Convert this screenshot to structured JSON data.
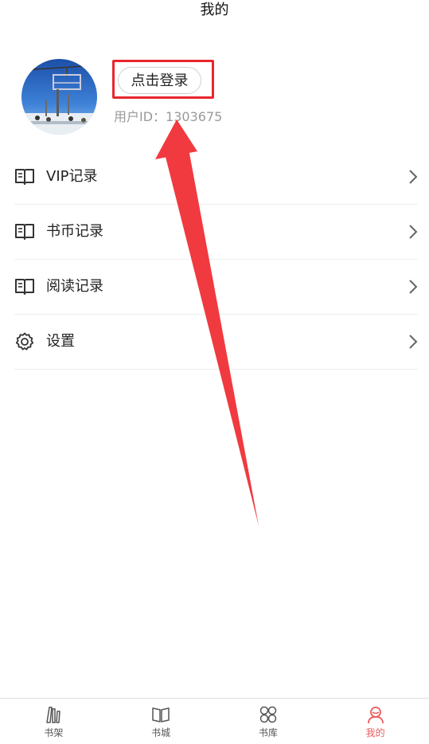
{
  "header": {
    "title": "我的"
  },
  "profile": {
    "login_label": "点击登录",
    "user_id": "用户ID：1303675"
  },
  "menu": [
    {
      "label": "VIP记录",
      "icon": "book-icon"
    },
    {
      "label": "书币记录",
      "icon": "book-icon"
    },
    {
      "label": "阅读记录",
      "icon": "book-icon"
    },
    {
      "label": "设置",
      "icon": "gear-icon"
    }
  ],
  "tabbar": [
    {
      "label": "书架",
      "icon": "bookshelf-icon",
      "active": false
    },
    {
      "label": "书城",
      "icon": "book-open-icon",
      "active": false
    },
    {
      "label": "书库",
      "icon": "grid-circles-icon",
      "active": false
    },
    {
      "label": "我的",
      "icon": "person-icon",
      "active": true
    }
  ],
  "colors": {
    "highlight_red": "#e8262e",
    "active_tab": "#e85c5c",
    "secondary_text": "#9a9a9a"
  }
}
